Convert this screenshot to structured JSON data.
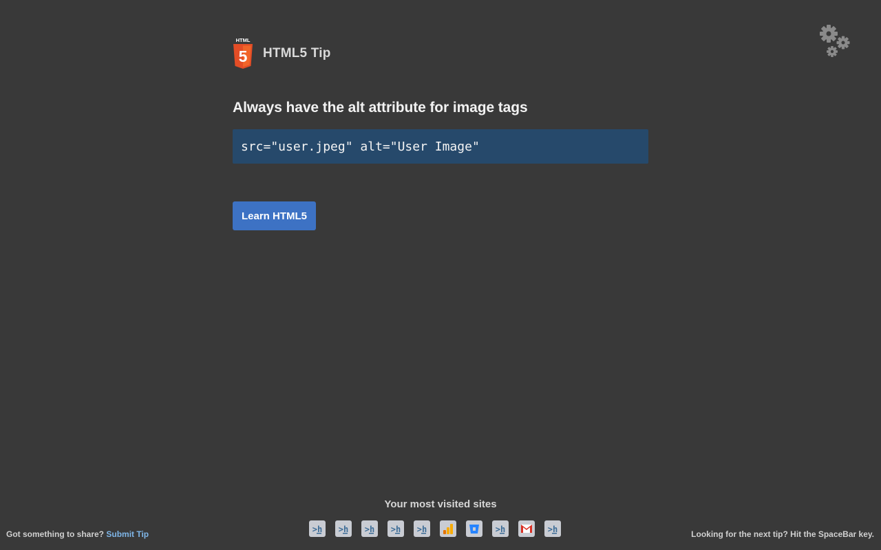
{
  "header": {
    "logo_label": "HTML",
    "logo_number": "5",
    "title": "HTML5 Tip"
  },
  "tip": {
    "heading": "Always have the alt attribute for image tags",
    "code": "src=\"user.jpeg\" alt=\"User Image\""
  },
  "actions": {
    "learn_label": "Learn HTML5"
  },
  "visited": {
    "title": "Your most visited sites",
    "sites": [
      {
        "icon": "hackerrank-icon"
      },
      {
        "icon": "hackerrank-icon"
      },
      {
        "icon": "hackerrank-icon"
      },
      {
        "icon": "hackerrank-icon"
      },
      {
        "icon": "hackerrank-icon"
      },
      {
        "icon": "analytics-icon"
      },
      {
        "icon": "bitbucket-icon"
      },
      {
        "icon": "hackerrank-icon"
      },
      {
        "icon": "gmail-icon"
      },
      {
        "icon": "hackerrank-icon"
      }
    ]
  },
  "footer": {
    "share_prompt": "Got something to share?",
    "submit_link": "Submit Tip",
    "next_tip_hint": "Looking for the next tip? Hit the SpaceBar key."
  },
  "colors": {
    "background": "#393939",
    "code_background": "#26496b",
    "button": "#3d72c4",
    "link": "#7fb6e8",
    "html5_orange": "#e44d26"
  }
}
